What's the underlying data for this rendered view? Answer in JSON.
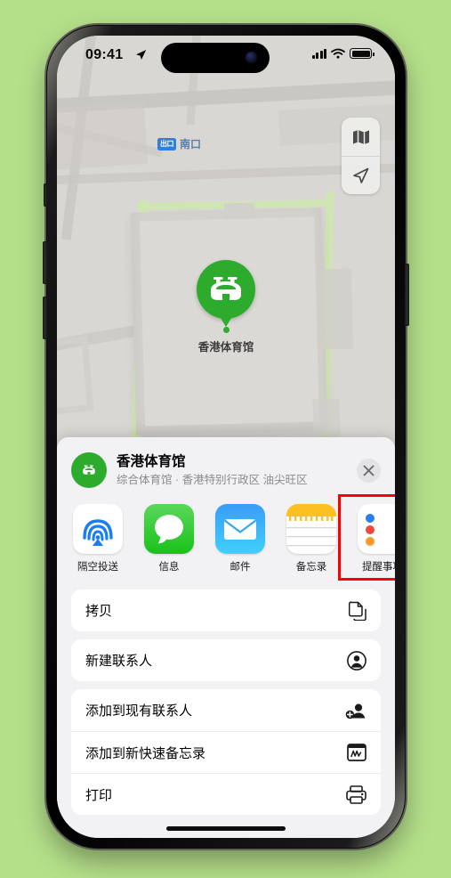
{
  "status_bar": {
    "time": "09:41",
    "location_arrow_icon": "location-arrow-icon",
    "signal_icon": "cellular-bars-icon",
    "wifi_icon": "wifi-icon",
    "battery_icon": "battery-icon"
  },
  "map": {
    "transit_badge": "出口",
    "transit_label": "南口",
    "pin_label": "香港体育馆",
    "pin_icon": "stadium-icon",
    "controls": [
      {
        "name": "map-layers-button",
        "icon": "folded-map-icon"
      },
      {
        "name": "current-location-button",
        "icon": "navigation-arrow-icon"
      }
    ]
  },
  "sheet": {
    "title": "香港体育馆",
    "subtitle": "综合体育馆 · 香港特别行政区 油尖旺区",
    "place_icon": "stadium-icon",
    "close_icon": "close-icon",
    "apps": [
      {
        "label": "隔空投送",
        "icon": "airdrop-icon",
        "highlighted": false
      },
      {
        "label": "信息",
        "icon": "messages-icon",
        "highlighted": false
      },
      {
        "label": "邮件",
        "icon": "mail-icon",
        "highlighted": false
      },
      {
        "label": "备忘录",
        "icon": "notes-icon",
        "highlighted": true
      },
      {
        "label": "提醒事项",
        "icon": "reminders-icon",
        "highlighted": false
      }
    ],
    "actions": [
      {
        "label": "拷贝",
        "icon": "copy-icon"
      },
      {
        "label": "新建联系人",
        "icon": "person-circle-icon"
      },
      {
        "label": "添加到现有联系人",
        "icon": "person-add-icon"
      },
      {
        "label": "添加到新快速备忘录",
        "icon": "quick-note-icon"
      },
      {
        "label": "打印",
        "icon": "printer-icon"
      }
    ]
  },
  "colors": {
    "background": "#b5e08a",
    "accent_green": "#2cab2c",
    "highlight_red": "#ff0000",
    "map_base": "#d9d7d3"
  }
}
